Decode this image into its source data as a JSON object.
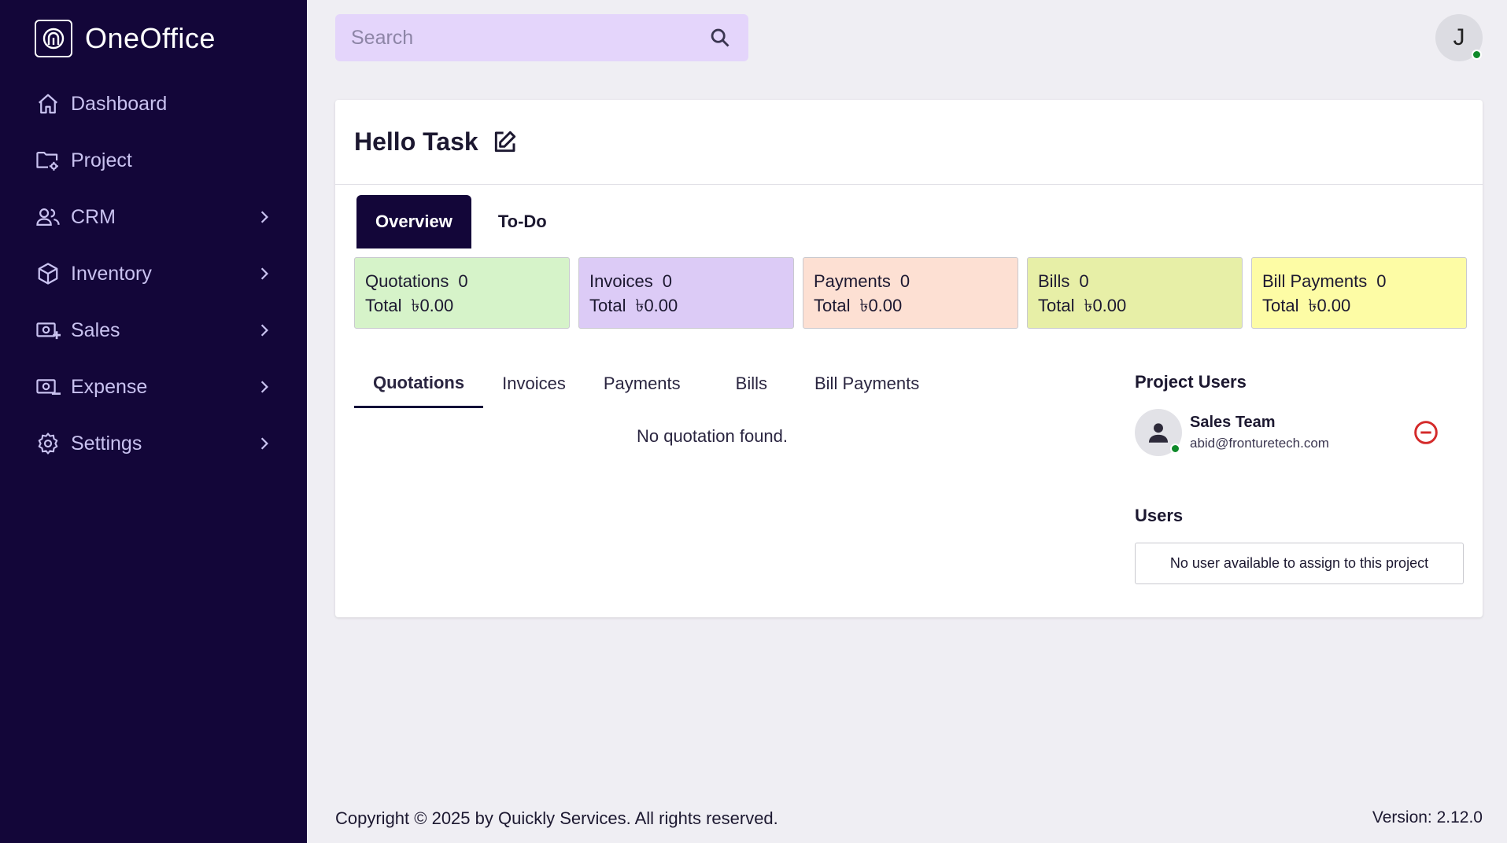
{
  "app": {
    "name": "OneOffice"
  },
  "sidebar": {
    "items": [
      {
        "label": "Dashboard",
        "icon": "home-icon",
        "has_chevron": false
      },
      {
        "label": "Project",
        "icon": "folder-gear-icon",
        "has_chevron": false
      },
      {
        "label": "CRM",
        "icon": "users-icon",
        "has_chevron": true
      },
      {
        "label": "Inventory",
        "icon": "box-icon",
        "has_chevron": true
      },
      {
        "label": "Sales",
        "icon": "cash-plus-icon",
        "has_chevron": true
      },
      {
        "label": "Expense",
        "icon": "cash-minus-icon",
        "has_chevron": true
      },
      {
        "label": "Settings",
        "icon": "gear-icon",
        "has_chevron": true
      }
    ]
  },
  "search": {
    "placeholder": "Search"
  },
  "user": {
    "initial": "J"
  },
  "project": {
    "title": "Hello Task"
  },
  "tabs": [
    {
      "label": "Overview",
      "active": true
    },
    {
      "label": "To-Do",
      "active": false
    }
  ],
  "stats": [
    {
      "label": "Quotations",
      "count": "0",
      "total_label": "Total",
      "total": "৳0.00",
      "color": "#d6f3c9"
    },
    {
      "label": "Invoices",
      "count": "0",
      "total_label": "Total",
      "total": "৳0.00",
      "color": "#dccbf6"
    },
    {
      "label": "Payments",
      "count": "0",
      "total_label": "Total",
      "total": "৳0.00",
      "color": "#fde0d3"
    },
    {
      "label": "Bills",
      "count": "0",
      "total_label": "Total",
      "total": "৳0.00",
      "color": "#e7efa7"
    },
    {
      "label": "Bill Payments",
      "count": "0",
      "total_label": "Total",
      "total": "৳0.00",
      "color": "#fdfca5"
    }
  ],
  "subtabs": [
    {
      "label": "Quotations",
      "active": true
    },
    {
      "label": "Invoices",
      "active": false
    },
    {
      "label": "Payments",
      "active": false
    },
    {
      "label": "Bills",
      "active": false
    },
    {
      "label": "Bill Payments",
      "active": false
    }
  ],
  "empty_message": "No quotation found.",
  "project_users": {
    "title": "Project Users",
    "items": [
      {
        "name": "Sales Team",
        "email": "abid@fronturetech.com"
      }
    ]
  },
  "users": {
    "title": "Users",
    "empty": "No user available to assign to this project"
  },
  "footer": {
    "copyright": "Copyright © 2025 by Quickly Services. All rights reserved.",
    "version": "Version: 2.12.0"
  },
  "colors": {
    "sidebar_bg": "#130639",
    "accent": "#130639",
    "search_bg": "#e4d5fb",
    "online": "#0f8a2a",
    "remove": "#d42a2a"
  }
}
